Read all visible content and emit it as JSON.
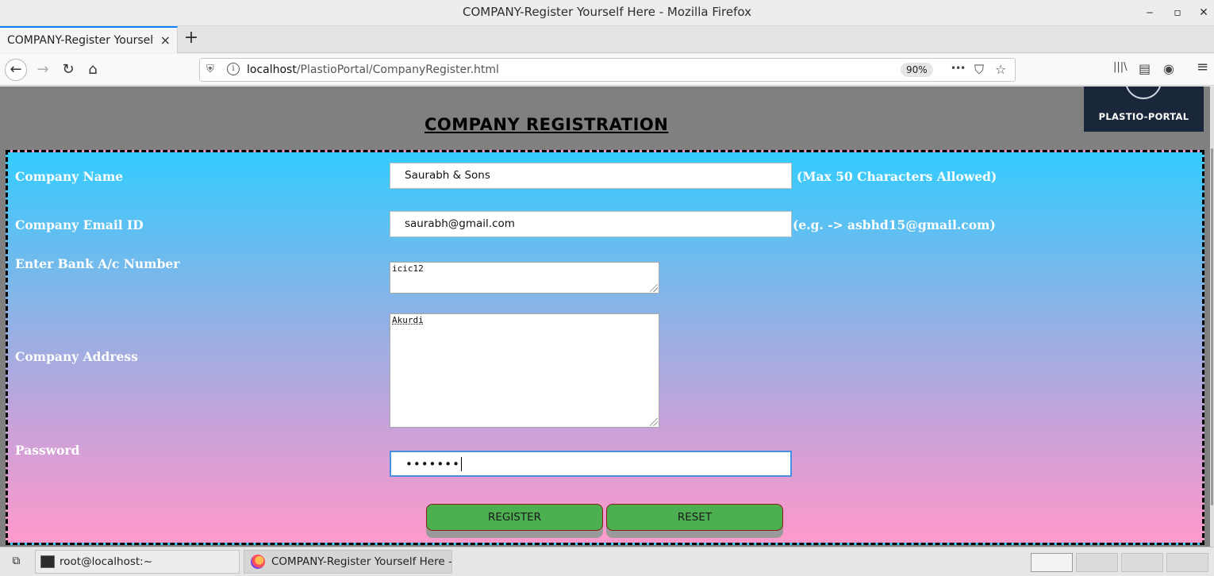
{
  "window": {
    "title": "COMPANY-Register Yourself Here - Mozilla Firefox",
    "minimize": "‒",
    "maximize": "▫",
    "close": "✕"
  },
  "tabs": [
    {
      "label": "COMPANY-Register Yourself Here - Mozilla Firefox",
      "close": "×"
    }
  ],
  "new_tab": "+",
  "nav": {
    "back": "←",
    "forward": "→",
    "reload": "↻",
    "home": "⌂",
    "url_host": "localhost",
    "url_path": "/PlastioPortal/CompanyRegister.html",
    "zoom": "90%",
    "more": "•••",
    "pocket": "⛉",
    "bookmark": "☆",
    "library": "|||\\",
    "sidebar": "▤",
    "account": "◉",
    "menu": "≡"
  },
  "page": {
    "logo_text": "PLASTIO-PORTAL",
    "heading": "COMPANY REGISTRATION",
    "fields": {
      "company_name": {
        "label": "Company Name",
        "value": "Saurabh & Sons",
        "hint": "(Max 50 Characters Allowed)"
      },
      "email": {
        "label": "Company Email ID",
        "value": "saurabh@gmail.com",
        "hint": "(e.g. -> asbhd15@gmail.com)"
      },
      "bank": {
        "label": "Enter Bank A/c Number",
        "value": "icic12"
      },
      "address": {
        "label": "Company Address",
        "value": "Akurdi"
      },
      "password": {
        "label": "Password",
        "value": "•••••••"
      }
    },
    "buttons": {
      "register": "REGISTER",
      "reset": "RESET"
    }
  },
  "taskbar": {
    "terminal": "root@localhost:~",
    "firefox": "COMPANY-Register Yourself Here - ..."
  }
}
